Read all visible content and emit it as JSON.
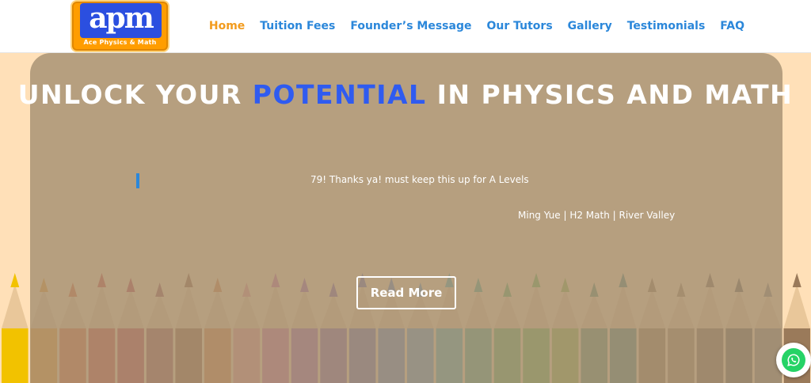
{
  "brand": {
    "logo_mark": "apm",
    "logo_tagline": "Ace Physics & Math"
  },
  "nav": {
    "items": [
      {
        "label": "Home",
        "active": true
      },
      {
        "label": "Tuition Fees",
        "active": false
      },
      {
        "label": "Founder’s Message",
        "active": false
      },
      {
        "label": "Our Tutors",
        "active": false
      },
      {
        "label": "Gallery",
        "active": false
      },
      {
        "label": "Testimonials",
        "active": false
      },
      {
        "label": "FAQ",
        "active": false
      }
    ]
  },
  "hero": {
    "title_before": "UNLOCK YOUR ",
    "title_accent": "POTENTIAL",
    "title_after": " IN PHYSICS AND MATH",
    "testimonial_text": "79! Thanks ya! must keep this up for A Levels",
    "testimonial_author": "Ming Yue | H2 Math | River Valley",
    "cta_label": "Read More"
  },
  "colors": {
    "accent": "#2f5bf0",
    "nav_link": "#2b87da",
    "nav_active": "#f29b1d",
    "logo_bg": "#ff9d00",
    "page_bg": "#ffe0b8",
    "whatsapp": "#25d366"
  },
  "icons": {
    "floating": "whatsapp-icon"
  }
}
